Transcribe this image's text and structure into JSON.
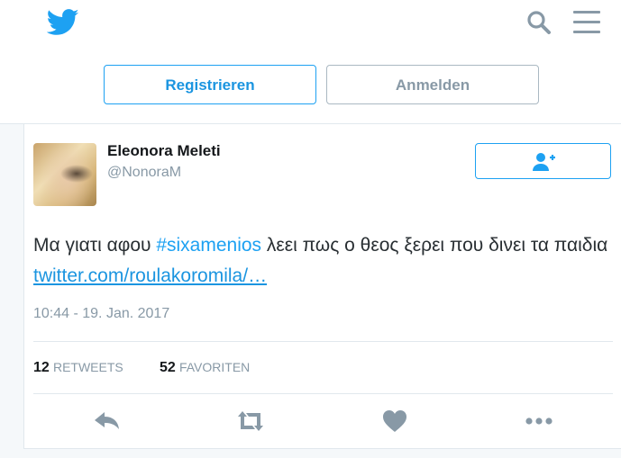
{
  "header": {
    "logo_icon": "twitter-bird-icon",
    "search_icon": "search-icon",
    "menu_icon": "hamburger-menu-icon",
    "register_label": "Registrieren",
    "login_label": "Anmelden"
  },
  "tweet": {
    "author_name": "Eleonora Meleti",
    "author_handle": "@NonoraM",
    "follow_icon": "add-user-icon",
    "text_before": "Μα γιατι αφου ",
    "hashtag": "#sixamenios",
    "text_after": " λεει πως ο θεος ξερει που δινει τα παιδια ",
    "link_text": "twitter.com/roulakoromila/…",
    "timestamp": "10:44 - 19. Jan. 2017",
    "retweets_count": "12",
    "retweets_label": "RETWEETS",
    "favorites_count": "52",
    "favorites_label": "FAVORITEN"
  },
  "actions": {
    "reply_icon": "reply-icon",
    "retweet_icon": "retweet-icon",
    "like_icon": "heart-icon",
    "more_icon": "more-dots-icon"
  },
  "colors": {
    "brand": "#1da1f2",
    "muted": "#8899a6",
    "background": "#f5f8fa"
  }
}
